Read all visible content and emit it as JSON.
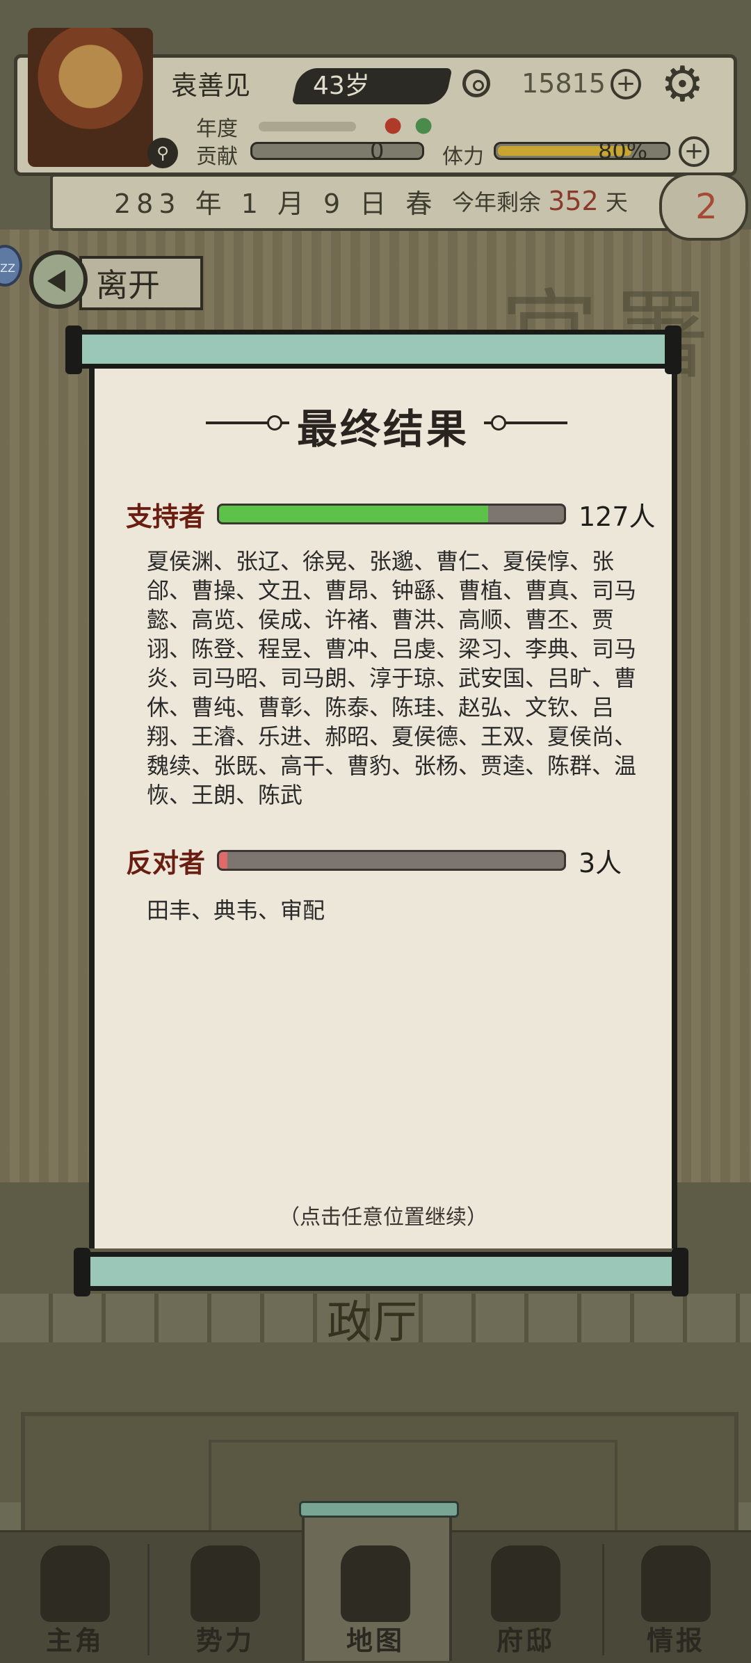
{
  "header": {
    "name": "袁善见",
    "age": "43岁",
    "gold": "15815",
    "year_label": "年度",
    "contribution_label": "贡献",
    "contribution_value": "0",
    "stamina_label": "体力",
    "stamina_value": "80%",
    "stamina_fraction": 0.8
  },
  "date_bar": {
    "date": "283 年 1 月 9 日 春",
    "remaining_prefix": "今年剩余",
    "remaining_days": "352",
    "remaining_suffix": "天",
    "cloud_count": "2"
  },
  "leave_button": {
    "label": "离开"
  },
  "badge": {
    "text": "ZZ"
  },
  "background": {
    "hall_label": "政厅",
    "big_chars": "官署"
  },
  "result_dialog": {
    "title": "最终结果",
    "supporters": {
      "label": "支持者",
      "count": "127人",
      "fraction": 0.78,
      "names": "夏侯渊、张辽、徐晃、张邈、曹仁、夏侯惇、张郃、曹操、文丑、曹昂、钟繇、曹植、曹真、司马懿、高览、侯成、许褚、曹洪、高顺、曹丕、贾诩、陈登、程昱、曹冲、吕虔、梁习、李典、司马炎、司马昭、司马朗、淳于琼、武安国、吕旷、曹休、曹纯、曹彰、陈泰、陈珪、赵弘、文钦、吕翔、王濬、乐进、郝昭、夏侯德、王双、夏侯尚、魏续、张既、高干、曹豹、张杨、贾逵、陈群、温恢、王朗、陈武",
      "color": "#5cc24a"
    },
    "opponents": {
      "label": "反对者",
      "count": "3人",
      "fraction": 0.023,
      "names": "田丰、典韦、审配",
      "color": "#e06a6a"
    },
    "continue_hint": "（点击任意位置继续）"
  },
  "bottom_nav": {
    "items": [
      {
        "label": "主角",
        "icon": "general-icon"
      },
      {
        "label": "势力",
        "icon": "flag-icon"
      },
      {
        "label": "地图",
        "icon": "map-icon"
      },
      {
        "label": "府邸",
        "icon": "mansion-icon"
      },
      {
        "label": "情报",
        "icon": "scroll-icon"
      }
    ],
    "active_index": 2
  }
}
